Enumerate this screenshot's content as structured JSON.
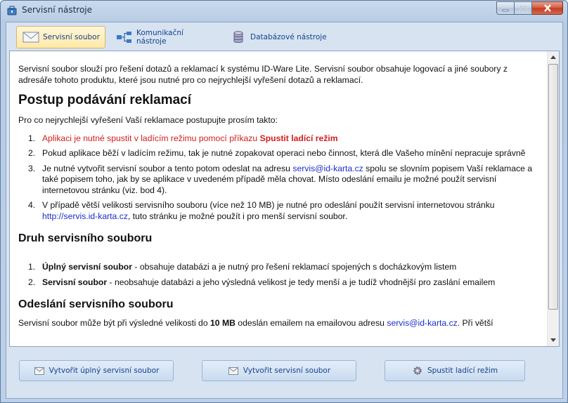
{
  "window": {
    "title": "Servisní nástroje",
    "icons": {
      "app": "toolbox-icon",
      "minimize": "minimize-icon",
      "maximize": "maximize-icon",
      "close": "close-icon"
    }
  },
  "tabs": [
    {
      "label": "Servisní soubor",
      "icon": "envelope-icon",
      "active": true
    },
    {
      "label": "Komunikační nástroje",
      "icon": "network-icon",
      "active": false
    },
    {
      "label": "Databázové nástroje",
      "icon": "database-icon",
      "active": false
    }
  ],
  "doc": {
    "intro": "Servisní soubor slouží pro řešení dotazů a reklamací k systému ID-Ware Lite. Servisní soubor obsahuje logovací a jiné soubory z adresáře tohoto produktu, které jsou nutné pro co nejrychlejší vyřešení dotazů a reklamací.",
    "h1": "Postup podávání reklamací",
    "lead": "Pro co nejrychlejší vyřešení Vaší reklamace postupujte prosím takto:",
    "steps": [
      {
        "num": "1.",
        "text": "Aplikaci je nutné spustit v ladícím režimu pomocí příkazu ",
        "bold": "Spustit ladící režim"
      },
      {
        "num": "2.",
        "text": "Pokud aplikace běží v ladícím režimu, tak je nutné zopakovat operaci nebo činnost, která dle Vašeho mínění nepracuje správně"
      },
      {
        "num": "3.",
        "pre": "Je nutné vytvořit servisní soubor a tento potom odeslat na adresu ",
        "link": "servis@id-karta.cz",
        "post": " spolu se slovním popisem Vaší reklamace a také popisem toho, jak by se aplikace v uvedeném případě měla chovat. Místo odeslání emailu je možné použít servisní internetovou stránku (viz. bod 4)."
      },
      {
        "num": "4.",
        "pre": "V případě větší velikosti servisního souboru (více než 10 MB) je nutné pro odeslání použít servisní internetovou stránku ",
        "link": "http://servis.id-karta.cz",
        "post": ", tuto stránku je možné použít i pro menší servisní soubor."
      }
    ],
    "h2_types": "Druh servisního souboru",
    "types": [
      {
        "num": "1.",
        "bold": "Úplný servisní soubor",
        "text": " - obsahuje databázi a je nutný pro řešení reklamací spojených s docházkovým listem"
      },
      {
        "num": "2.",
        "bold": "Servisní soubor",
        "text": " - neobsahuje databázi a jeho výsledná velikost je tedy menší a je tudíž vhodnější pro zaslání emailem"
      }
    ],
    "h2_send": "Odeslání servisního souboru",
    "send_pre": "Servisní soubor může být při výsledné velikosti do ",
    "send_bold": "10 MB",
    "send_mid": " odeslán emailem na emailovou adresu ",
    "send_link": "servis@id-karta.cz",
    "send_post": ". Při větší"
  },
  "buttons": [
    {
      "label": "Vytvořit úplný servisní soubor",
      "icon": "envelope-icon"
    },
    {
      "label": "Vytvořit servisní soubor",
      "icon": "envelope-icon"
    },
    {
      "label": "Spustit ladící režim",
      "icon": "gear-icon"
    }
  ]
}
